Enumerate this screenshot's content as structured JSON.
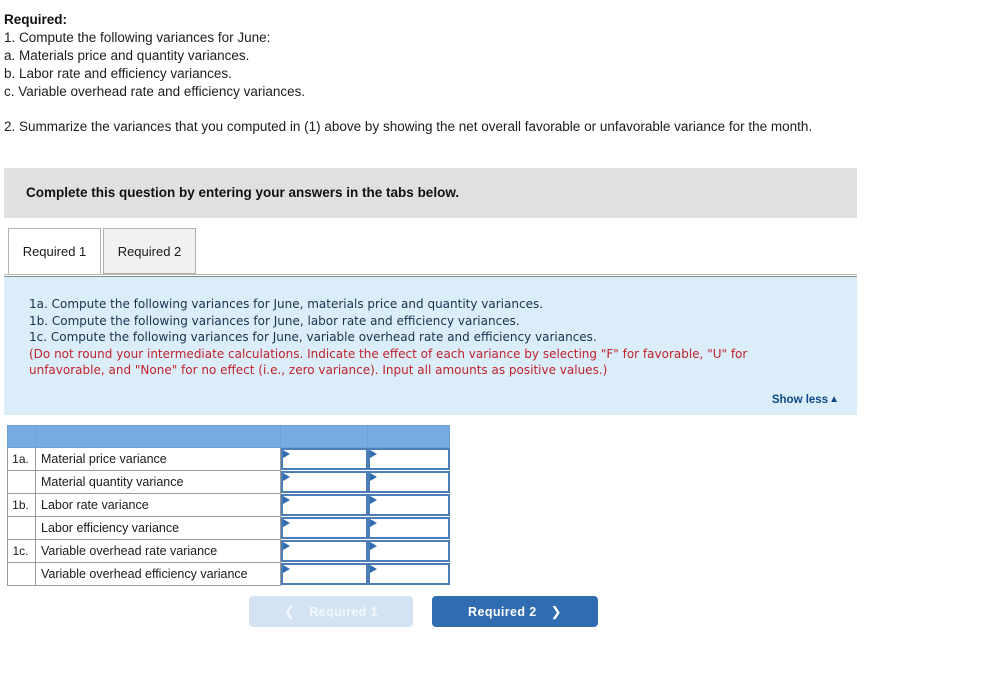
{
  "required_block": {
    "title": "Required:",
    "lines": [
      "1. Compute the following variances for June:",
      "a. Materials price and quantity variances.",
      "b. Labor rate and efficiency variances.",
      "c. Variable overhead rate and efficiency variances."
    ],
    "summary_line": "2. Summarize the variances that you computed in (1) above by showing the net overall favorable or unfavorable variance for the month."
  },
  "banner": {
    "text": "Complete this question by entering your answers in the tabs below."
  },
  "tabs": [
    {
      "label": "Required 1",
      "active": true
    },
    {
      "label": "Required 2",
      "active": false
    }
  ],
  "info_panel": {
    "lines": [
      "1a. Compute the following variances for June, materials price and quantity variances.",
      "1b. Compute the following variances for June, labor rate and efficiency variances.",
      "1c. Compute the following variances for June, variable overhead rate and efficiency variances."
    ],
    "note_lines": [
      "(Do not round your intermediate calculations. Indicate the effect of each variance by selecting \"F\" for favorable, \"U\" for",
      "unfavorable, and \"None\" for no effect (i.e., zero variance). Input all amounts as positive values.)"
    ],
    "show_less_label": "Show less",
    "show_less_caret": "▲",
    "bg_color": "#dcedfa",
    "note_color": "#c0222b",
    "link_color": "#0c4a86"
  },
  "answer_table": {
    "header_color": "#76abdf",
    "header_cells": [
      "",
      "",
      "",
      ""
    ],
    "rows": [
      {
        "index": "1a.",
        "label": "Material price variance",
        "value_a": "",
        "value_b": ""
      },
      {
        "index": "",
        "label": "Material quantity variance",
        "value_a": "",
        "value_b": ""
      },
      {
        "index": "1b.",
        "label": "Labor rate variance",
        "value_a": "",
        "value_b": ""
      },
      {
        "index": "",
        "label": "Labor efficiency variance",
        "value_a": "",
        "value_b": ""
      },
      {
        "index": "1c.",
        "label": "Variable overhead rate variance",
        "value_a": "",
        "value_b": ""
      },
      {
        "index": "",
        "label": "Variable overhead efficiency variance",
        "value_a": "",
        "value_b": ""
      }
    ]
  },
  "nav": {
    "prev": {
      "label": "Required 1",
      "chevron": "❮",
      "enabled": false,
      "color": "#d4e3f2"
    },
    "next": {
      "label": "Required 2",
      "chevron": "❯",
      "enabled": true,
      "color": "#2f6cb0"
    }
  }
}
